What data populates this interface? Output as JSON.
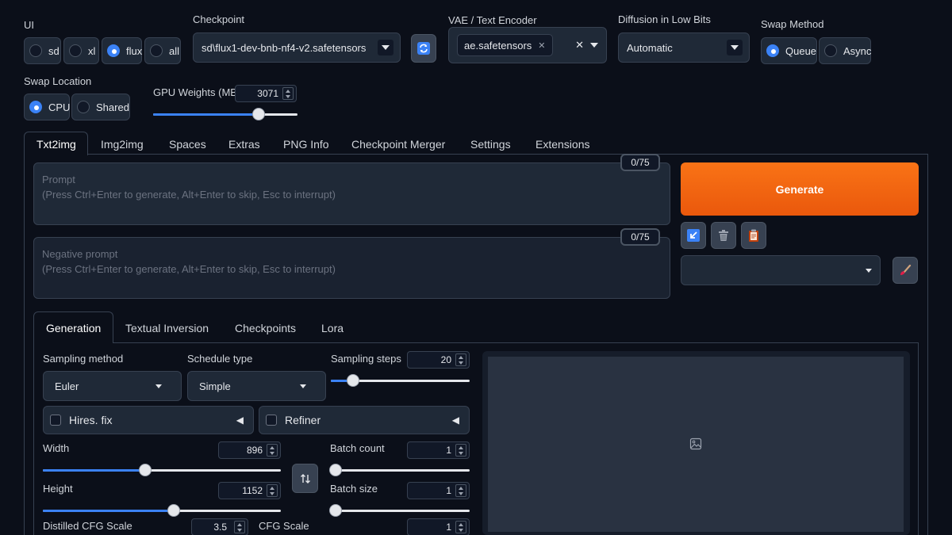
{
  "ui": {
    "label": "UI",
    "options": [
      "sd",
      "xl",
      "flux",
      "all"
    ],
    "selected": "flux"
  },
  "checkpoint": {
    "label": "Checkpoint",
    "value": "sd\\flux1-dev-bnb-nf4-v2.safetensors"
  },
  "vae": {
    "label": "VAE / Text Encoder",
    "chip": "ae.safetensors"
  },
  "diffusion_low_bits": {
    "label": "Diffusion in Low Bits",
    "value": "Automatic"
  },
  "swap_method": {
    "label": "Swap Method",
    "options": [
      "Queue",
      "Async"
    ],
    "selected": "Queue"
  },
  "swap_location": {
    "label": "Swap Location",
    "options": [
      "CPU",
      "Shared"
    ],
    "selected": "CPU"
  },
  "gpu_weights": {
    "label": "GPU Weights (MB)",
    "value": "3071",
    "fraction": 0.73
  },
  "main_tabs": [
    "Txt2img",
    "Img2img",
    "Spaces",
    "Extras",
    "PNG Info",
    "Checkpoint Merger",
    "Settings",
    "Extensions"
  ],
  "active_main_tab": "Txt2img",
  "prompt": {
    "label": "Prompt",
    "placeholder": "(Press Ctrl+Enter to generate, Alt+Enter to skip, Esc to interrupt)",
    "counter": "0/75"
  },
  "negative_prompt": {
    "label": "Negative prompt",
    "placeholder": "(Press Ctrl+Enter to generate, Alt+Enter to skip, Esc to interrupt)",
    "counter": "0/75"
  },
  "generate_label": "Generate",
  "sub_tabs": [
    "Generation",
    "Textual Inversion",
    "Checkpoints",
    "Lora"
  ],
  "active_sub_tab": "Generation",
  "sampling_method": {
    "label": "Sampling method",
    "value": "Euler"
  },
  "schedule_type": {
    "label": "Schedule type",
    "value": "Simple"
  },
  "sampling_steps": {
    "label": "Sampling steps",
    "value": "20",
    "fraction": 0.16
  },
  "hires_fix": {
    "label": "Hires. fix"
  },
  "refiner": {
    "label": "Refiner"
  },
  "width": {
    "label": "Width",
    "value": "896",
    "fraction": 0.43
  },
  "height": {
    "label": "Height",
    "value": "1152",
    "fraction": 0.55
  },
  "batch_count": {
    "label": "Batch count",
    "value": "1",
    "fraction": 0.0
  },
  "batch_size": {
    "label": "Batch size",
    "value": "1",
    "fraction": 0.0
  },
  "distilled_cfg": {
    "label": "Distilled CFG Scale",
    "value": "3.5"
  },
  "cfg_scale": {
    "label": "CFG Scale",
    "value": "1"
  },
  "colors": {
    "accent": "#3b82f6",
    "generate_start": "#f97316",
    "generate_end": "#ea580c",
    "background": "#0b0f19"
  }
}
